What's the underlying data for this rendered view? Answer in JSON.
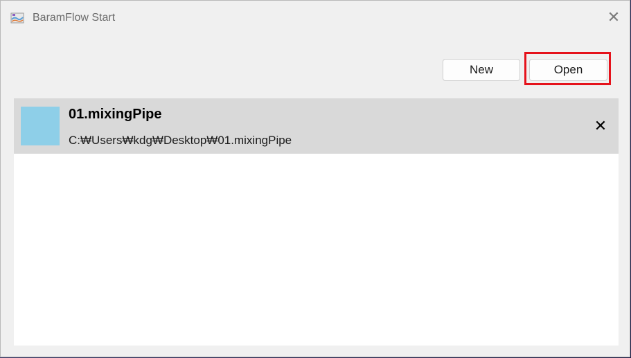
{
  "window": {
    "title": "BaramFlow Start",
    "close_glyph": "✕"
  },
  "toolbar": {
    "new_label": "New",
    "open_label": "Open",
    "highlight_color": "#e5121b"
  },
  "projects": [
    {
      "name": "01.mixingPipe",
      "path": "C:₩Users₩kdg₩Desktop₩01.mixingPipe",
      "thumbnail_color": "#8ecfe8",
      "remove_glyph": "✕",
      "selected": true
    }
  ],
  "icons": {
    "app": "app-icon",
    "close": "close-icon",
    "remove": "remove-icon"
  }
}
